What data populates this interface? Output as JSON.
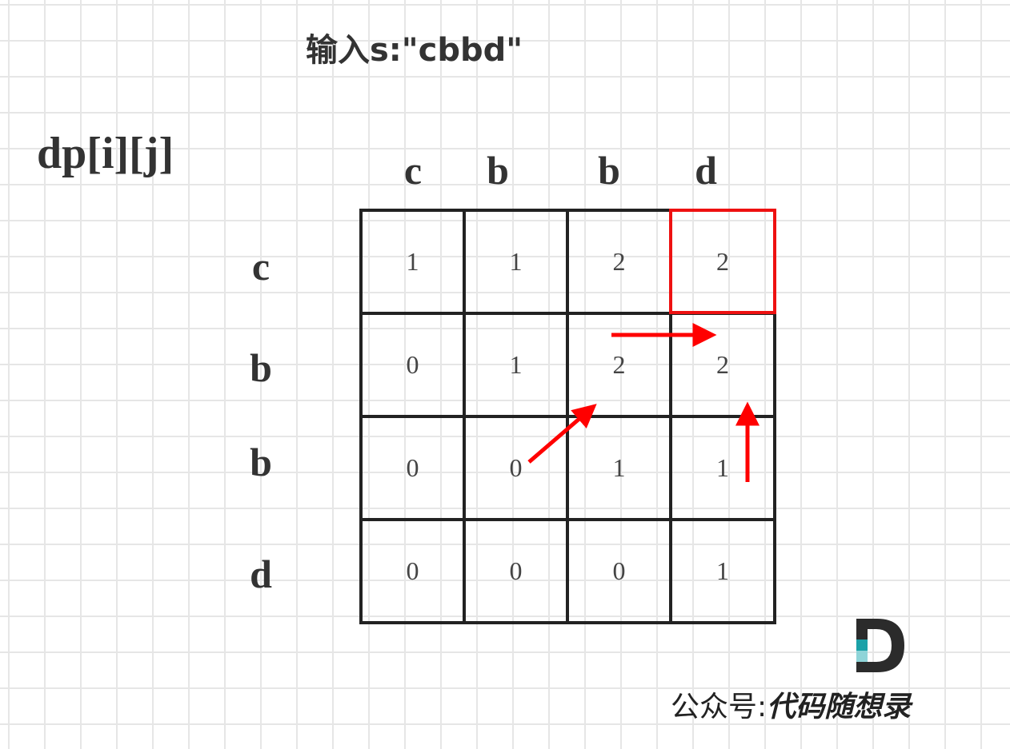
{
  "title": "输入s:\"cbbd\"",
  "dp_label": "dp[i][j]",
  "column_labels": [
    "c",
    "b",
    "b",
    "d"
  ],
  "row_labels": [
    "c",
    "b",
    "b",
    "d"
  ],
  "table": [
    [
      "1",
      "1",
      "2",
      "2"
    ],
    [
      "0",
      "1",
      "2",
      "2"
    ],
    [
      "0",
      "0",
      "1",
      "1"
    ],
    [
      "0",
      "0",
      "0",
      "1"
    ]
  ],
  "highlight_cell": {
    "row": 0,
    "col": 3,
    "color": "#ee1111"
  },
  "arrow_color": "#ff0000",
  "logo": {
    "prefix": "公众号:",
    "brand": "代码随想录",
    "colors": {
      "dark": "#2b2b2b",
      "teal": "#1ba1a8"
    }
  }
}
